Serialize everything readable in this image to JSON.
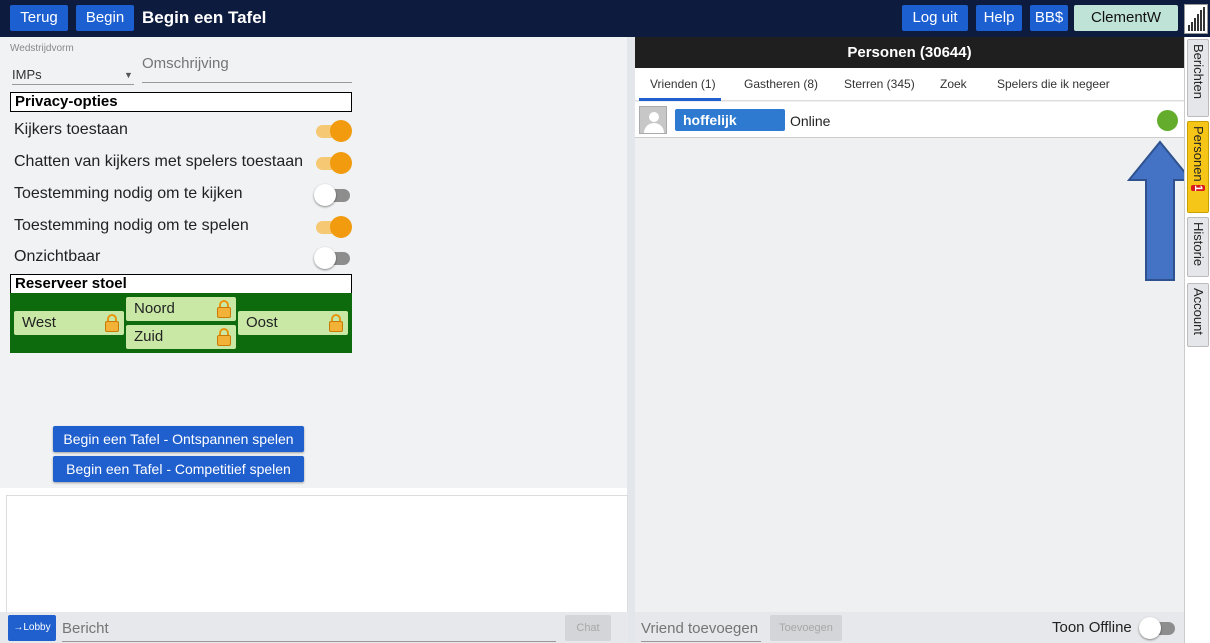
{
  "topbar": {
    "back_label": "Terug",
    "start_label": "Begin",
    "title": "Begin een Tafel",
    "logout_label": "Log uit",
    "help_label": "Help",
    "bbs_label": "BB$",
    "username": "ClementW",
    "signal_icon": "signal-bars-icon"
  },
  "form": {
    "competition_label": "Wedstrijdvorm",
    "competition_value": "IMPs",
    "description_placeholder": "Omschrijving"
  },
  "privacy": {
    "heading": "Privacy-opties",
    "options": [
      {
        "label": "Kijkers toestaan",
        "on": true
      },
      {
        "label": "Chatten van kijkers met spelers toestaan",
        "on": true
      },
      {
        "label": "Toestemming nodig om te kijken",
        "on": false
      },
      {
        "label": "Toestemming nodig om te spelen",
        "on": true
      },
      {
        "label": "Onzichtbaar",
        "on": false
      }
    ]
  },
  "seats": {
    "heading": "Reserveer stoel",
    "north": "Noord",
    "west": "West",
    "east": "Oost",
    "south": "Zuid"
  },
  "actions": {
    "relaxed": "Begin een Tafel - Ontspannen spelen",
    "competitive": "Begin een Tafel - Competitief spelen"
  },
  "chat": {
    "lobby_label": "→Lobby",
    "message_placeholder": "Bericht",
    "chat_label": "Chat"
  },
  "persons": {
    "heading": "Personen (30644)",
    "tabs": [
      "Vrienden (1)",
      "Gastheren (8)",
      "Sterren (345)",
      "Zoek",
      "Spelers die ik negeer"
    ],
    "friends": [
      {
        "name": "hoffelijk",
        "status": "Online"
      }
    ],
    "add_friend_placeholder": "Vriend toevoegen",
    "add_label": "Toevoegen",
    "show_offline_label": "Toon Offline",
    "show_offline_on": false
  },
  "sidebar": {
    "tabs": [
      {
        "label": "Berichten"
      },
      {
        "label": "Personen",
        "badge": "1"
      },
      {
        "label": "Historie"
      },
      {
        "label": "Account"
      }
    ]
  },
  "colors": {
    "topbar_bg": "#0d1b3e",
    "button_blue": "#1c5fd1",
    "toggle_on": "#f29b0e",
    "seat_bg": "#0d6b0d",
    "online_green": "#64ad2c",
    "active_tab": "#f5c518",
    "arrow_blue": "#4472c4"
  }
}
